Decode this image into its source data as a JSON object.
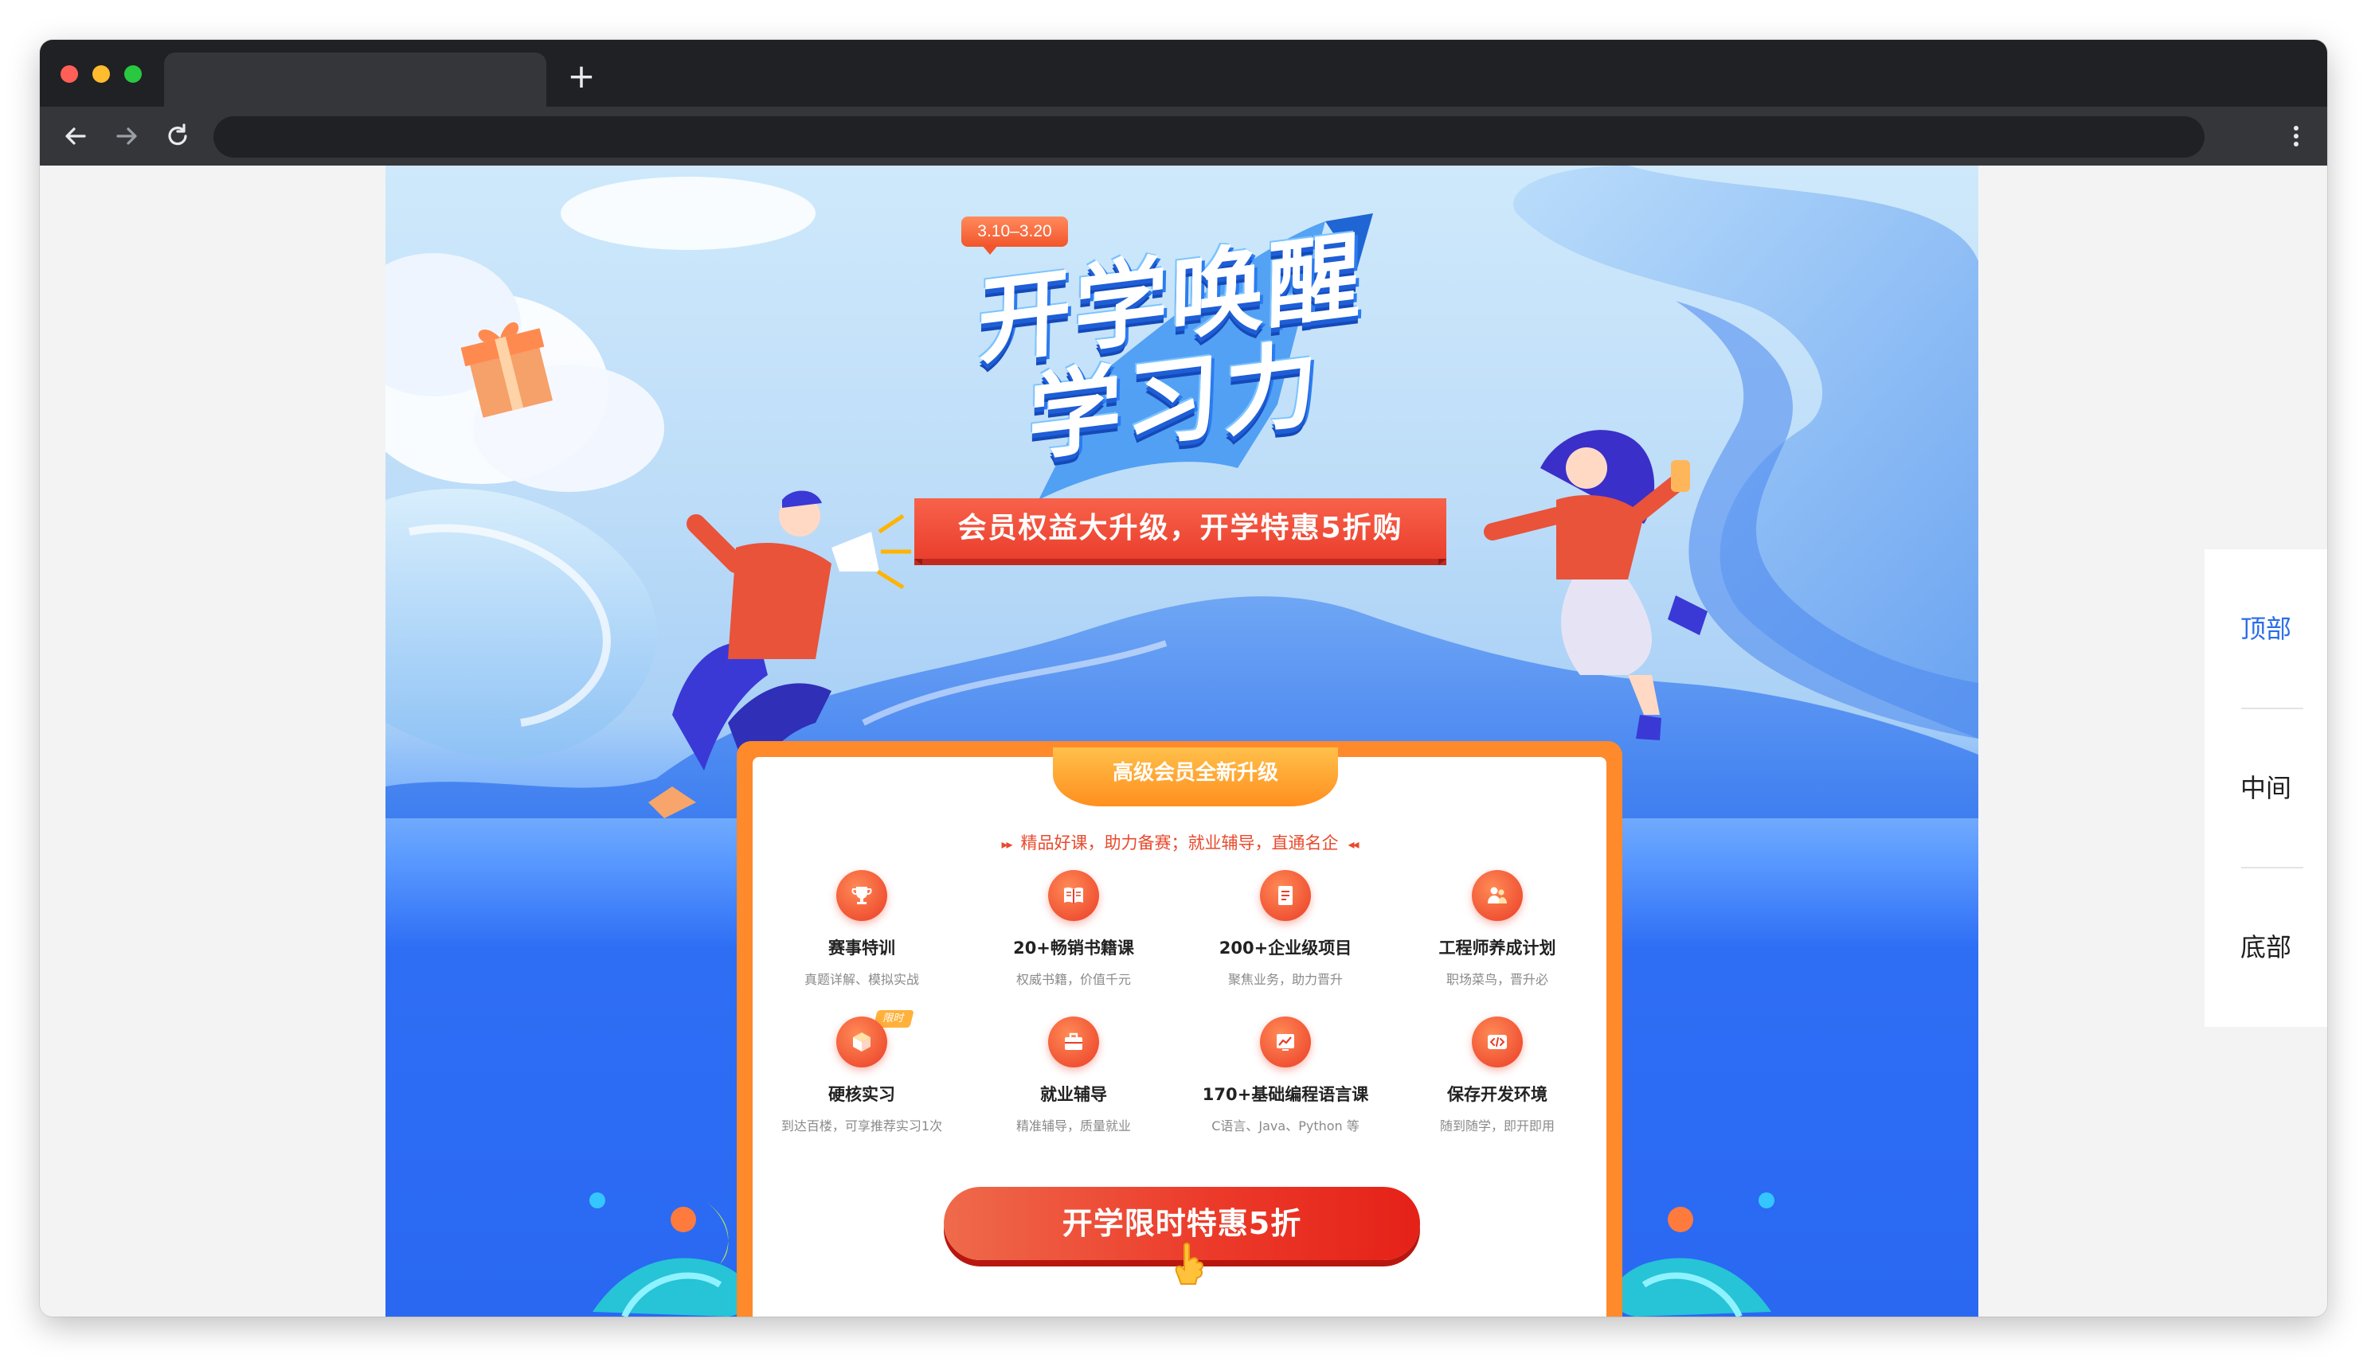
{
  "browser": {
    "tab_title": "",
    "new_tab_symbol": "+",
    "address": "",
    "icons": [
      "back-arrow-icon",
      "forward-arrow-icon",
      "reload-icon",
      "more-vertical-icon"
    ]
  },
  "hero": {
    "date_badge": "3.10–3.20",
    "title_line1": "开学唤醒",
    "title_line2": "学习力",
    "ribbon": "会员权益大升级，开学特惠5折购"
  },
  "card": {
    "tab_label": "高级会员全新升级",
    "tagline": "精品好课，助力备赛；就业辅导，直通名企",
    "features": [
      {
        "title": "赛事特训",
        "desc": "真题详解、模拟实战",
        "icon": "trophy-icon"
      },
      {
        "title": "20+畅销书籍课",
        "desc": "权威书籍，价值千元",
        "icon": "book-icon"
      },
      {
        "title": "200+企业级项目",
        "desc": "聚焦业务，助力晋升",
        "icon": "document-icon"
      },
      {
        "title": "工程师养成计划",
        "desc": "职场菜鸟，晋升必",
        "icon": "people-icon"
      },
      {
        "title": "硬核实习",
        "desc": "到达百楼，可享推荐实习1次",
        "icon": "box-icon",
        "badge": "限时"
      },
      {
        "title": "就业辅导",
        "desc": "精准辅导，质量就业",
        "icon": "briefcase-icon"
      },
      {
        "title": "170+基础编程语言课",
        "desc": "C语言、Java、Python 等",
        "icon": "chart-icon"
      },
      {
        "title": "保存开发环境",
        "desc": "随到随学，即开即用",
        "icon": "code-icon"
      }
    ],
    "cta": "开学限时特惠5折"
  },
  "side_nav": {
    "items": [
      {
        "label": "顶部",
        "active": true
      },
      {
        "label": "中间",
        "active": false
      },
      {
        "label": "底部",
        "active": false
      }
    ]
  },
  "colors": {
    "accent_red": "#ea3f2e",
    "accent_orange": "#ff8a2b",
    "page_blue": "#2a68f2",
    "side_active": "#2a6ee8"
  }
}
